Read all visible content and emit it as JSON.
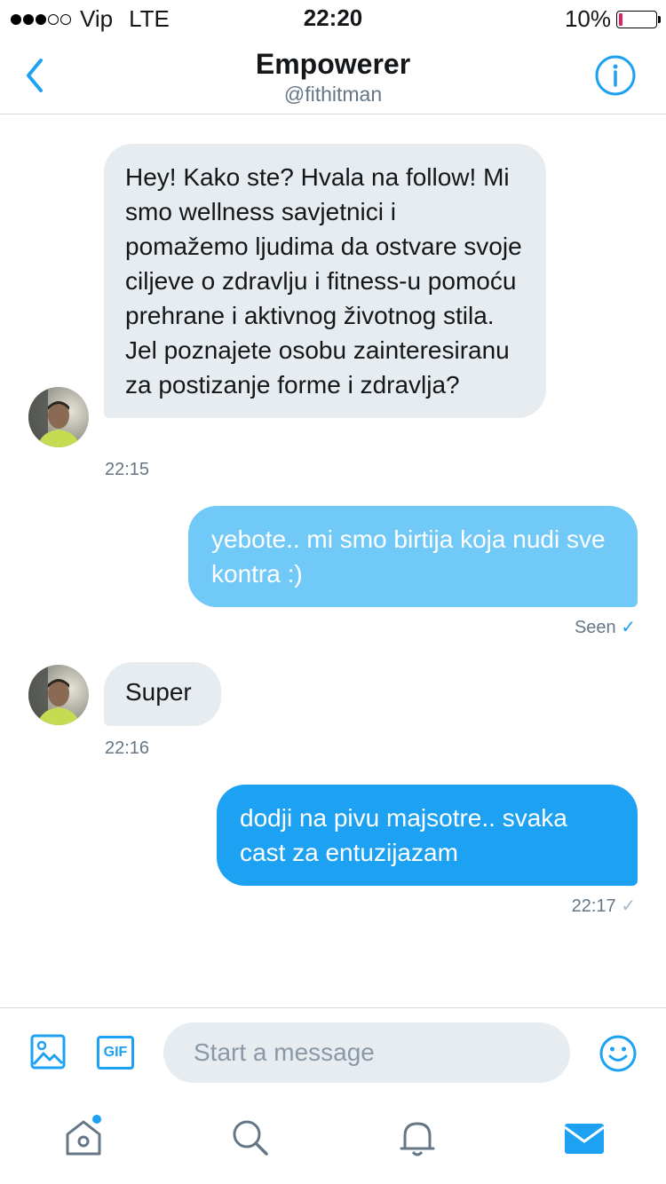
{
  "status_bar": {
    "carrier": "Vip",
    "network": "LTE",
    "time": "22:20",
    "battery": "10%",
    "battery_level": 0.1
  },
  "header": {
    "title": "Empowerer",
    "handle": "@fithitman",
    "back_icon": "chevron-left-icon",
    "info_icon": "info-icon"
  },
  "messages": [
    {
      "from": "them",
      "text": "Hey! Kako ste? Hvala na follow! Mi smo wellness savjetnici i pomažemo ljudima da ostvare svoje ciljeve o zdravlju i fitness-u pomoću prehrane i aktivnog životnog stila. Jel poznajete osobu zainteresiranu za postizanje forme i zdravlja?",
      "time": "22:15"
    },
    {
      "from": "me",
      "text": "yebote.. mi smo birtija koja nudi sve kontra :)",
      "status": "Seen"
    },
    {
      "from": "them",
      "text": "Super",
      "time": "22:16"
    },
    {
      "from": "me",
      "text": "dodji na pivu majsotre.. svaka cast za entuzijazam",
      "time": "22:17"
    }
  ],
  "composer": {
    "placeholder": "Start a message",
    "gif_label": "GIF",
    "icons": [
      "image-icon",
      "gif-icon",
      "emoji-icon"
    ]
  },
  "tab_bar": {
    "items": [
      "home-icon",
      "search-icon",
      "notifications-icon",
      "messages-icon"
    ],
    "active": "messages-icon"
  },
  "colors": {
    "accent": "#1da1f2",
    "bubble_in": "#e6ecf0",
    "bubble_seen": "#71c9f8",
    "battery_low": "#e0245e"
  }
}
